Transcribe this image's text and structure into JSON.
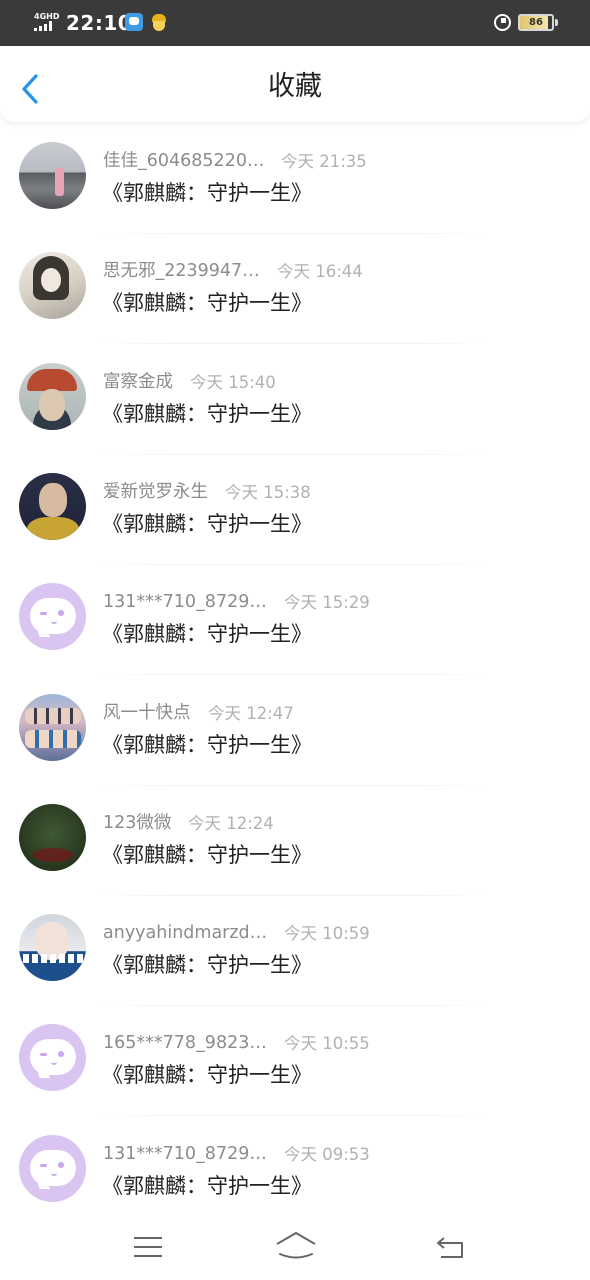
{
  "status_bar": {
    "network": "4GHD",
    "time": "22:10",
    "battery": "86",
    "battery_level": 0.86,
    "icons": [
      "signal-icon",
      "app-notification-icon",
      "app-notification-icon-2",
      "alarm-icon",
      "battery-icon"
    ]
  },
  "header": {
    "back_icon": "chevron-left-icon",
    "title": "收藏",
    "accent": "#2196e8"
  },
  "items": [
    {
      "name": "佳佳_604685220…",
      "time": "今天 21:35",
      "title": "《郭麒麟：守护一生》",
      "avatar": "photo"
    },
    {
      "name": "思无邪_2239947…",
      "time": "今天 16:44",
      "title": "《郭麒麟：守护一生》",
      "avatar": "photo"
    },
    {
      "name": "富察金成",
      "time": "今天 15:40",
      "title": "《郭麒麟：守护一生》",
      "avatar": "photo"
    },
    {
      "name": "爱新觉罗永生",
      "time": "今天 15:38",
      "title": "《郭麒麟：守护一生》",
      "avatar": "photo"
    },
    {
      "name": "131***710_8729…",
      "time": "今天 15:29",
      "title": "《郭麒麟：守护一生》",
      "avatar": "default"
    },
    {
      "name": "风一十快点",
      "time": "今天 12:47",
      "title": "《郭麒麟：守护一生》",
      "avatar": "photo"
    },
    {
      "name": "123微微",
      "time": "今天 12:24",
      "title": "《郭麒麟：守护一生》",
      "avatar": "photo"
    },
    {
      "name": "anyyahindmarzd…",
      "time": "今天 10:59",
      "title": "《郭麒麟：守护一生》",
      "avatar": "photo"
    },
    {
      "name": "165***778_9823…",
      "time": "今天 10:55",
      "title": "《郭麒麟：守护一生》",
      "avatar": "default"
    },
    {
      "name": "131***710_8729…",
      "time": "今天 09:53",
      "title": "《郭麒麟：守护一生》",
      "avatar": "default"
    }
  ],
  "colors": {
    "default_avatar_bg": "#d9c4f2",
    "name_text": "#8c8c8c",
    "time_text": "#b1b1b1",
    "title_text": "#222222"
  },
  "nav_bar": {
    "icons": [
      "menu-icon",
      "home-icon",
      "back-icon"
    ]
  }
}
